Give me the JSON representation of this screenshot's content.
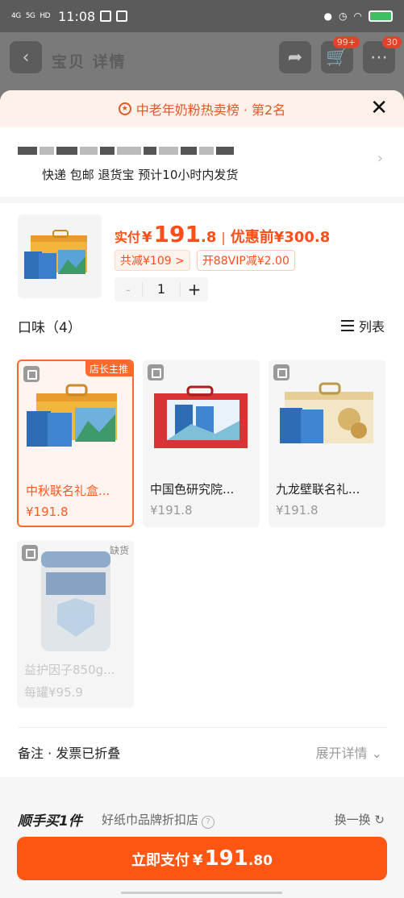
{
  "status_bar": {
    "signal_1": "4G",
    "signal_2": "5G",
    "hd": "HD",
    "time": "11:08"
  },
  "background_page": {
    "title": "宝贝 详情",
    "cart_badge": "99+",
    "msg_badge": "30"
  },
  "banner": {
    "text": "中老年奶粉热卖榜 · 第2名"
  },
  "address": {
    "shipping": "快递 包邮 退货宝 预计10小时内发货"
  },
  "product": {
    "paid_label": "实付",
    "currency": "¥",
    "price_int": "191",
    "price_dec": ".8",
    "before_label": "优惠前",
    "before_price": "¥300.8",
    "discount_tag": "共减¥109 >",
    "vip_tag": "开88VIP减¥2.00",
    "quantity": "1",
    "minus": "-",
    "plus": "+"
  },
  "flavors": {
    "title": "口味（4）",
    "view_toggle": "列表",
    "items": [
      {
        "name": "中秋联名礼盒...",
        "price": "¥191.8",
        "ribbon": "店长主推",
        "selected": true
      },
      {
        "name": "中国色研究院...",
        "price": "¥191.8"
      },
      {
        "name": "九龙壁联名礼...",
        "price": "¥191.8"
      },
      {
        "name": "益护因子850g...",
        "price": "每罐¥95.9",
        "status": "缺货"
      }
    ]
  },
  "remark": {
    "label": "备注 · 发票已折叠",
    "expand": "展开详情"
  },
  "addon": {
    "title": "顺手买1件",
    "store": "好纸巾品牌折扣店",
    "switch": "换一换"
  },
  "pay": {
    "label": "立即支付",
    "currency": "¥",
    "amount_int": "191",
    "amount_dec": ".80"
  },
  "colors": {
    "accent": "#ff5614",
    "price": "#ff4e1a"
  }
}
